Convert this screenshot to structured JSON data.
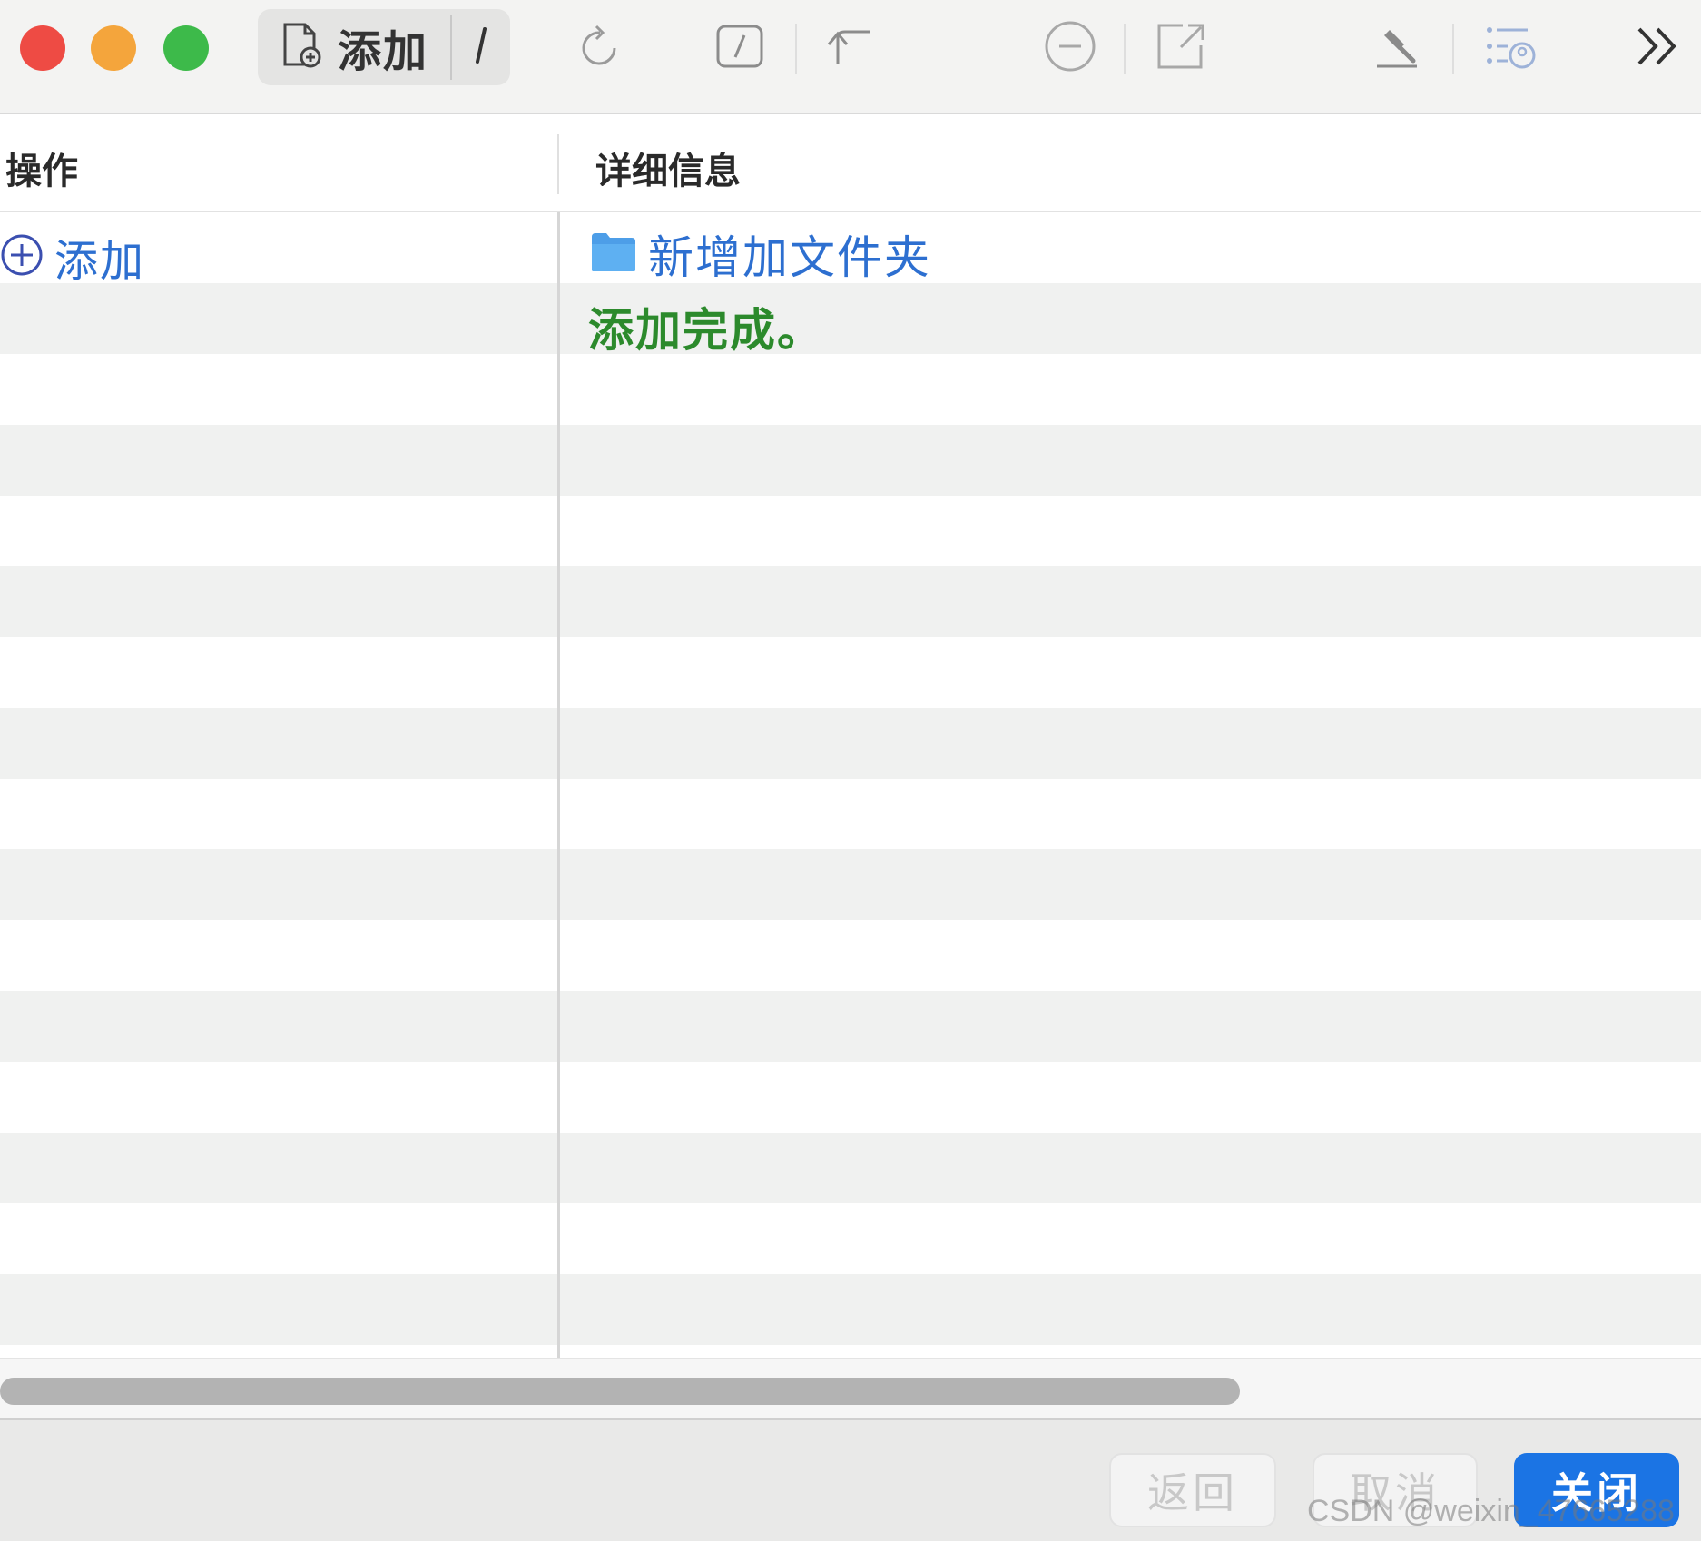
{
  "toolbar": {
    "add_label": "添加",
    "icons": [
      "doc-add-icon",
      "pencil-icon",
      "refresh-icon",
      "edit-square-icon",
      "undo-arrow-icon",
      "minus-circle-icon",
      "external-link-icon",
      "hammer-icon",
      "list-user-icon",
      "chevron-double-right-icon"
    ]
  },
  "table": {
    "columns": [
      "操作",
      "详细信息"
    ],
    "rows": [
      {
        "operation": "添加",
        "detail": "新增加文件夹",
        "type": "folder"
      },
      {
        "operation": "",
        "detail": "添加完成。",
        "type": "status"
      }
    ]
  },
  "footer": {
    "back_label": "返回",
    "cancel_label": "取消",
    "close_label": "关闭"
  },
  "watermark": "CSDN @weixin_47665288",
  "colors": {
    "accent": "#1b74e4",
    "link_blue": "#2d6fd0",
    "success_green": "#2c8a2c",
    "close_red": "#ee4b44",
    "minimize_orange": "#f4a53c",
    "maximize_green": "#3dba4a"
  }
}
